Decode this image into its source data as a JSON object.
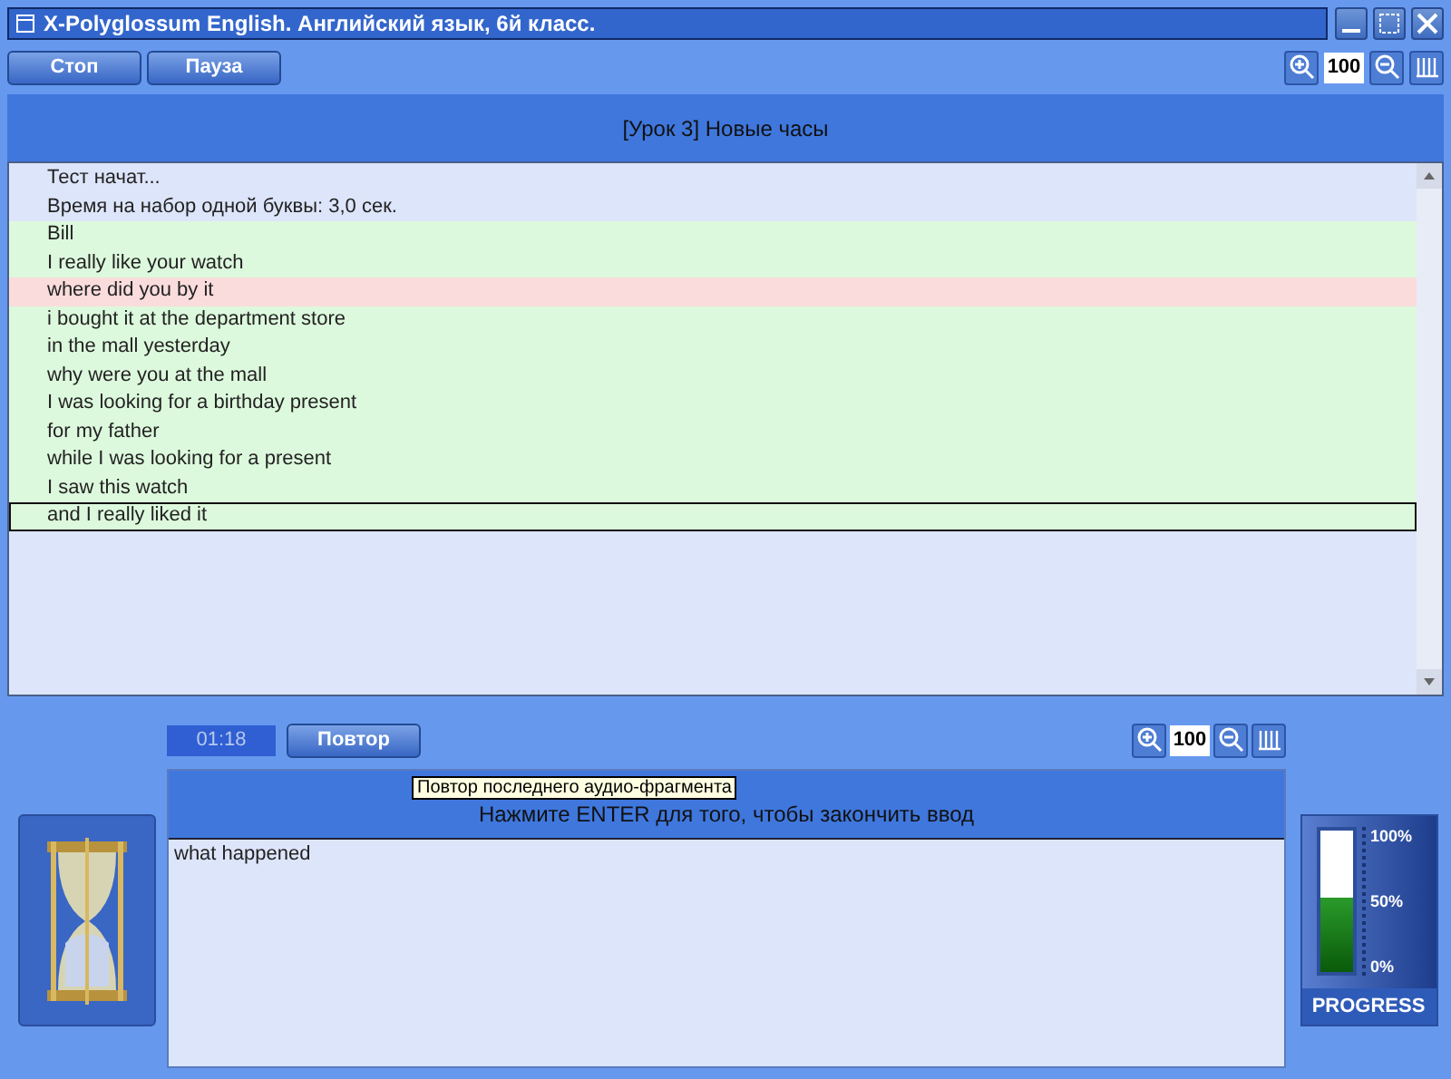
{
  "window": {
    "title": "X-Polyglossum English. Английский язык, 6й класс."
  },
  "toolbar": {
    "buttons": [
      "Стоп",
      "Пауза"
    ],
    "zoom": "100"
  },
  "lesson": {
    "title": "[Урок 3] Новые часы"
  },
  "log": [
    {
      "text": "Тест начат...",
      "kind": "info",
      "selected": false
    },
    {
      "text": "Время на набор одной буквы: 3,0 сек.",
      "kind": "info",
      "selected": false
    },
    {
      "text": "Bill",
      "kind": "correct",
      "selected": false
    },
    {
      "text": "I really like your watch",
      "kind": "correct",
      "selected": false
    },
    {
      "text": "where did you by it",
      "kind": "wrong",
      "selected": false
    },
    {
      "text": "i bought it at the department store",
      "kind": "correct",
      "selected": false
    },
    {
      "text": "in the mall yesterday",
      "kind": "correct",
      "selected": false
    },
    {
      "text": "why were you at the mall",
      "kind": "correct",
      "selected": false
    },
    {
      "text": "I was looking for a birthday present",
      "kind": "correct",
      "selected": false
    },
    {
      "text": "for my father",
      "kind": "correct",
      "selected": false
    },
    {
      "text": "while I was looking for a present",
      "kind": "correct",
      "selected": false
    },
    {
      "text": "I saw this watch",
      "kind": "correct",
      "selected": false
    },
    {
      "text": "and I really liked it",
      "kind": "correct",
      "selected": true
    }
  ],
  "controls": {
    "timer": "01:18",
    "repeat_button": "Повтор",
    "zoom": "100",
    "tooltip": "Повтор последнего аудио-фрагмента"
  },
  "input": {
    "hint": "Нажмите ENTER для того, чтобы закончить ввод",
    "value": "what happened"
  },
  "progress": {
    "level": 0.52,
    "labels": [
      "100%",
      "50%",
      "0%"
    ],
    "caption": "PROGRESS"
  }
}
